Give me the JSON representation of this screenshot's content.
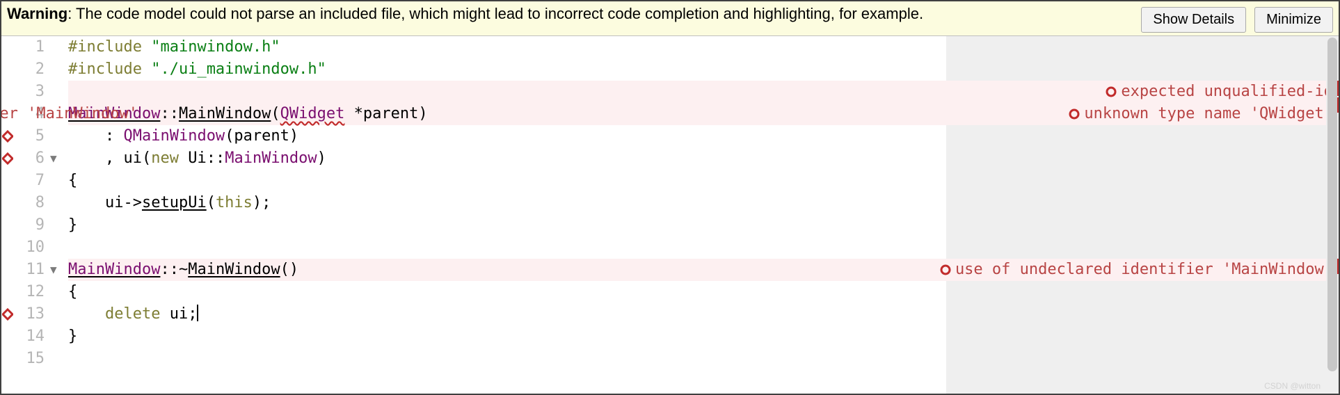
{
  "warning": {
    "label_strong": "Warning",
    "text": ": The code model could not parse an included file, which might lead to incorrect code completion and highlighting, for example.",
    "show_details": "Show Details",
    "minimize": "Minimize"
  },
  "colors": {
    "error": "#c12a2a",
    "annotation_text": "#b84444",
    "warning_bg": "#fcfcdf",
    "error_line_bg": "#fdf0f1",
    "annot_col_bg": "#efefef"
  },
  "lines": {
    "l1": {
      "num": "1",
      "pre": "#include ",
      "str": "\"mainwindow.h\""
    },
    "l2": {
      "num": "2",
      "pre": "#include ",
      "str": "\"./ui_mainwindow.h\""
    },
    "l3": {
      "num": "3"
    },
    "l4": {
      "num": "4",
      "a": "MainWindow",
      "b": "::",
      "c": "MainWindow",
      "d": "(",
      "e": "QWidget",
      "f": " *parent)"
    },
    "l5": {
      "num": "5",
      "indent": "    ",
      "a": ": ",
      "b": "QMainWindow",
      "c": "(parent)"
    },
    "l6": {
      "num": "6",
      "indent": "    ",
      "a": ", ui(",
      "kw": "new",
      "b": " Ui::",
      "c": "MainWindow",
      "d": ")"
    },
    "l7": {
      "num": "7",
      "text": "{"
    },
    "l8": {
      "num": "8",
      "indent": "    ",
      "a": "ui->",
      "b": "setupUi",
      "c": "(",
      "kw": "this",
      "d": ");"
    },
    "l9": {
      "num": "9",
      "text": "}"
    },
    "l10": {
      "num": "10"
    },
    "l11": {
      "num": "11",
      "a": "MainWindow",
      "b": "::~",
      "c": "MainWindow",
      "d": "()"
    },
    "l12": {
      "num": "12",
      "text": "{"
    },
    "l13": {
      "num": "13",
      "indent": "    ",
      "kw": "delete",
      "a": " ui;"
    },
    "l14": {
      "num": "14",
      "text": "}"
    },
    "l15": {
      "num": "15"
    }
  },
  "annotations": {
    "l3": {
      "right": "expected unqualified-id"
    },
    "l4": {
      "left": "use of undeclared identifier 'MainWindow'",
      "right": "unknown type name 'QWidget'"
    },
    "l11": {
      "right": "use of undeclared identifier 'MainWindow'"
    }
  },
  "watermark": "CSDN @witton"
}
